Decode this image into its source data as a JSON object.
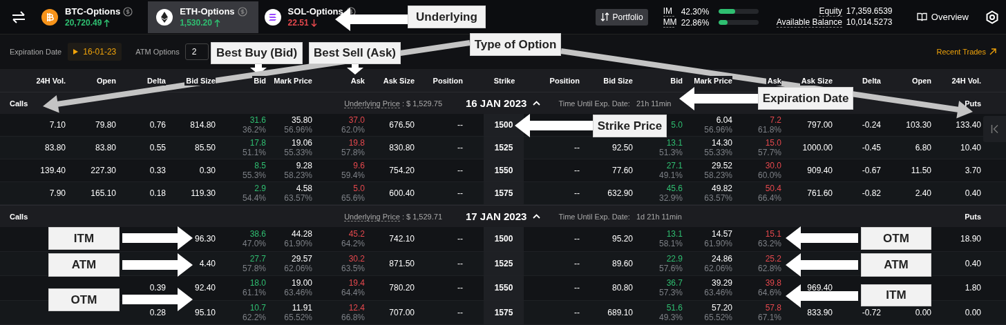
{
  "topbar": {
    "tabs": [
      {
        "name": "BTC-Options",
        "price": "20,720.49",
        "rising": true,
        "kind": "btc",
        "selected": false
      },
      {
        "name": "ETH-Options",
        "price": "1,530.20",
        "rising": true,
        "kind": "eth",
        "selected": true
      },
      {
        "name": "SOL-Options",
        "price": "22.51",
        "rising": false,
        "kind": "sol",
        "selected": false
      }
    ],
    "portfolio_button": "Portfolio",
    "margins": [
      {
        "label": "IM",
        "value": "42.30%",
        "level": 0.42
      },
      {
        "label": "MM",
        "value": "22.86%",
        "level": 0.23
      }
    ],
    "balances": [
      {
        "label": "Equity",
        "value": "17,359.6539"
      },
      {
        "label": "Available Balance",
        "value": "10,014.5273"
      }
    ],
    "overview": "Overview"
  },
  "filters": {
    "expiration_label": "Expiration Date",
    "expiration_value": "16-01-23",
    "atm_label": "ATM Options",
    "atm_value": "2",
    "recent_trades": "Recent Trades"
  },
  "table": {
    "call_columns": [
      "24H Vol.",
      "Open",
      "Delta",
      "Bid Size",
      "Bid",
      "Mark Price",
      "Ask",
      "Ask Size",
      "Position"
    ],
    "strike_column": "Strike",
    "put_columns": [
      "Position",
      "Bid Size",
      "Bid",
      "Mark Price",
      "Ask",
      "Ask Size",
      "Delta",
      "Open",
      "24H Vol."
    ],
    "sections": [
      {
        "calls_label": "Calls",
        "underlying_label": "Underlying Price",
        "underlying_value": ": $ 1,529.75",
        "date": "16 JAN 2023",
        "time_label": "Time Until Exp. Date:",
        "time_value": "21h 11min",
        "puts_label": "Puts",
        "rows": [
          {
            "strike": "1500",
            "calls": {
              "vol": "7.10",
              "open": "79.80",
              "delta": "0.76",
              "bid_size": "814.80",
              "bid": "31.6",
              "bid_iv": "36.2%",
              "mark": "35.80",
              "mark_iv": "56.96%",
              "ask": "37.0",
              "ask_iv": "62.0%",
              "ask_size": "676.50",
              "position": "--"
            },
            "puts": {
              "bid": "5.0",
              "mark": "6.04",
              "mark_iv": "56.96%",
              "ask": "7.2",
              "ask_iv": "61.8%",
              "ask_size": "797.00",
              "delta": "-0.24",
              "open": "103.30",
              "vol": "133.40"
            }
          },
          {
            "strike": "1525",
            "calls": {
              "vol": "83.80",
              "open": "83.80",
              "delta": "0.55",
              "bid_size": "85.50",
              "bid": "17.8",
              "bid_iv": "51.1%",
              "mark": "19.06",
              "mark_iv": "55.33%",
              "ask": "19.8",
              "ask_iv": "57.8%",
              "ask_size": "830.80",
              "position": "--"
            },
            "puts": {
              "position": "--",
              "bid_size": "92.50",
              "bid": "13.1",
              "bid_iv": "51.3%",
              "mark": "14.30",
              "mark_iv": "55.33%",
              "ask": "15.0",
              "ask_iv": "57.7%",
              "ask_size": "1000.00",
              "delta": "-0.45",
              "open": "6.80",
              "vol": "10.40"
            }
          },
          {
            "strike": "1550",
            "calls": {
              "vol": "139.40",
              "open": "227.30",
              "delta": "0.33",
              "bid_size": "0.30",
              "bid": "8.5",
              "bid_iv": "55.3%",
              "mark": "9.28",
              "mark_iv": "58.23%",
              "ask": "9.6",
              "ask_iv": "59.4%",
              "ask_size": "754.20",
              "position": "--"
            },
            "puts": {
              "position": "--",
              "bid_size": "77.60",
              "bid": "27.1",
              "bid_iv": "49.1%",
              "mark": "29.52",
              "mark_iv": "58.23%",
              "ask": "30.0",
              "ask_iv": "60.0%",
              "ask_size": "909.40",
              "delta": "-0.67",
              "open": "11.50",
              "vol": "3.70"
            }
          },
          {
            "strike": "1575",
            "calls": {
              "vol": "7.90",
              "open": "165.10",
              "delta": "0.18",
              "bid_size": "119.30",
              "bid": "2.9",
              "bid_iv": "54.4%",
              "mark": "4.58",
              "mark_iv": "63.57%",
              "ask": "5.0",
              "ask_iv": "65.6%",
              "ask_size": "600.40",
              "position": "--"
            },
            "puts": {
              "position": "--",
              "bid_size": "632.90",
              "bid": "45.6",
              "bid_iv": "32.9%",
              "mark": "49.82",
              "mark_iv": "63.57%",
              "ask": "50.4",
              "ask_iv": "66.4%",
              "ask_size": "761.60",
              "delta": "-0.82",
              "open": "2.40",
              "vol": "0.40"
            }
          }
        ]
      },
      {
        "calls_label": "Calls",
        "underlying_label": "Underlying Price",
        "underlying_value": ": $ 1,529.71",
        "date": "17 JAN 2023",
        "time_label": "Time Until Exp. Date:",
        "time_value": "1d 21h 11min",
        "puts_label": "Puts",
        "rows": [
          {
            "strike": "1500",
            "calls": {
              "bid_size": "96.30",
              "bid": "38.6",
              "bid_iv": "47.0%",
              "mark": "44.28",
              "mark_iv": "61.90%",
              "ask": "45.2",
              "ask_iv": "64.2%",
              "ask_size": "742.10",
              "position": "--"
            },
            "puts": {
              "position": "--",
              "bid_size": "95.20",
              "bid": "13.1",
              "bid_iv": "58.1%",
              "mark": "14.57",
              "mark_iv": "61.90%",
              "ask": "15.1",
              "ask_iv": "63.2%",
              "vol": "18.90"
            }
          },
          {
            "strike": "1525",
            "calls": {
              "bid_size": "4.40",
              "bid": "27.7",
              "bid_iv": "57.8%",
              "mark": "29.57",
              "mark_iv": "62.06%",
              "ask": "30.2",
              "ask_iv": "63.5%",
              "ask_size": "871.50",
              "position": "--"
            },
            "puts": {
              "position": "--",
              "bid_size": "89.60",
              "bid": "22.9",
              "bid_iv": "57.6%",
              "mark": "24.86",
              "mark_iv": "62.06%",
              "ask": "25.2",
              "ask_iv": "62.8%",
              "vol": "0.40"
            }
          },
          {
            "strike": "1550",
            "calls": {
              "delta": "0.39",
              "bid_size": "92.40",
              "bid": "18.0",
              "bid_iv": "61.1%",
              "mark": "19.00",
              "mark_iv": "63.46%",
              "ask": "19.4",
              "ask_iv": "64.4%",
              "ask_size": "780.20",
              "position": "--"
            },
            "puts": {
              "position": "--",
              "bid_size": "80.80",
              "bid": "36.7",
              "bid_iv": "57.3%",
              "mark": "39.29",
              "mark_iv": "63.46%",
              "ask": "39.8",
              "ask_iv": "64.6%",
              "ask_size": "969.40",
              "vol": "1.80"
            }
          },
          {
            "strike": "1575",
            "calls": {
              "delta": "0.28",
              "bid_size": "95.10",
              "bid": "10.7",
              "bid_iv": "62.2%",
              "mark": "11.91",
              "mark_iv": "65.52%",
              "ask": "12.4",
              "ask_iv": "66.8%",
              "ask_size": "707.00",
              "position": "--"
            },
            "puts": {
              "position": "--",
              "bid_size": "689.10",
              "bid": "51.6",
              "bid_iv": "49.3%",
              "mark": "57.20",
              "mark_iv": "65.52%",
              "ask": "57.8",
              "ask_iv": "67.1%",
              "ask_size": "833.90",
              "delta": "-0.72",
              "open": "0.00",
              "vol": "0.00"
            }
          }
        ]
      }
    ]
  },
  "annotations": [
    {
      "text": "Underlying"
    },
    {
      "text": "Best Buy (Bid)"
    },
    {
      "text": "Best Sell (Ask)"
    },
    {
      "text": "Type of Option"
    },
    {
      "text": "Expiration Date"
    },
    {
      "text": "Strike Price"
    },
    {
      "text": "ITM"
    },
    {
      "text": "ATM"
    },
    {
      "text": "OTM"
    },
    {
      "text": "OTM"
    },
    {
      "text": "ATM"
    },
    {
      "text": "ITM"
    }
  ]
}
